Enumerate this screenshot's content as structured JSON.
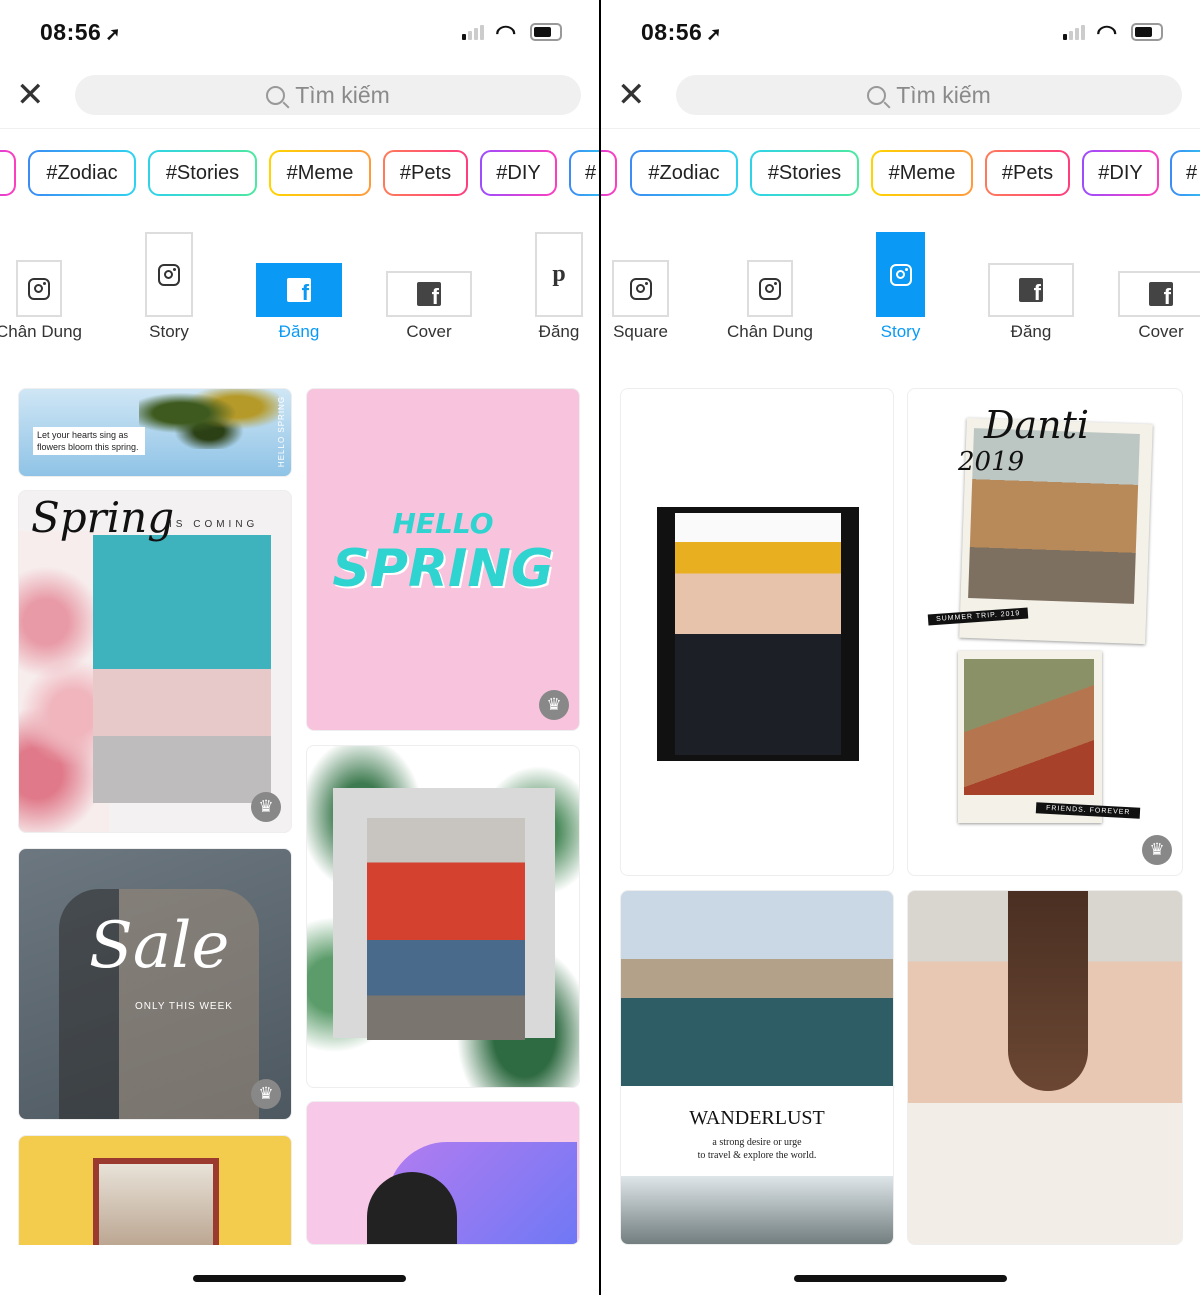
{
  "colors": {
    "accent": "#0a9af5",
    "divider": "#000000"
  },
  "panels": [
    {
      "status": {
        "time": "08:56",
        "location_icon": "location-arrow-icon"
      },
      "search": {
        "placeholder": "Tìm kiếm"
      },
      "tags": [
        "#Zodiac",
        "#Stories",
        "#Meme",
        "#Pets",
        "#DIY",
        "#"
      ],
      "formats": [
        {
          "label": "Chân Dung",
          "icon": "instagram-icon",
          "selected": false
        },
        {
          "label": "Story",
          "icon": "instagram-icon",
          "selected": false
        },
        {
          "label": "Đăng",
          "icon": "facebook-icon",
          "selected": true
        },
        {
          "label": "Cover",
          "icon": "facebook-icon",
          "selected": false
        },
        {
          "label": "Đăng",
          "icon": "pinterest-icon",
          "selected": false
        }
      ],
      "templates": {
        "banner": {
          "text": "Let your hearts sing as flowers bloom this spring.",
          "side": "HELLO SPRING"
        },
        "spring_coming": {
          "script": "Spring",
          "sub": "IS COMING",
          "premium": true
        },
        "hello_spring": {
          "line1": "HELLO",
          "line2": "SPRING",
          "premium": true
        },
        "sale": {
          "script": "Sale",
          "sub": "ONLY THIS WEEK",
          "premium": true
        },
        "hoodie": {},
        "family": {},
        "wavy": {}
      }
    },
    {
      "status": {
        "time": "08:56",
        "location_icon": "location-arrow-icon"
      },
      "search": {
        "placeholder": "Tìm kiếm"
      },
      "tags": [
        "#Zodiac",
        "#Stories",
        "#Meme",
        "#Pets",
        "#DIY",
        "#"
      ],
      "formats": [
        {
          "label": "Square",
          "icon": "instagram-icon",
          "selected": false
        },
        {
          "label": "Chân Dung",
          "icon": "instagram-icon",
          "selected": false
        },
        {
          "label": "Story",
          "icon": "instagram-icon",
          "selected": true
        },
        {
          "label": "Đăng",
          "icon": "facebook-icon",
          "selected": false
        },
        {
          "label": "Cover",
          "icon": "facebook-icon",
          "selected": false
        }
      ],
      "templates": {
        "beanie": {},
        "danti": {
          "title": "Danti",
          "year": "2019",
          "caption1": "SUMMER TRIP. 2019",
          "caption2": "FRIENDS. FOREVER",
          "premium": true
        },
        "wanderlust": {
          "title": "WANDERLUST",
          "line1": "a strong desire or urge",
          "line2": "to travel & explore the world."
        },
        "bride": {}
      }
    }
  ]
}
